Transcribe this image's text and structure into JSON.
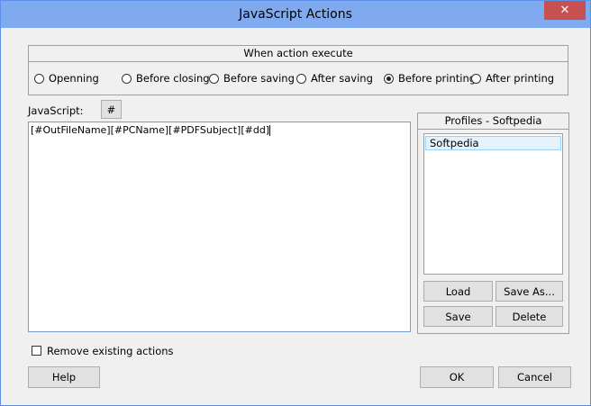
{
  "window": {
    "title": "JavaScript Actions",
    "close_glyph": "✕"
  },
  "action_group": {
    "title": "When action execute",
    "options": [
      {
        "label": "Openning",
        "selected": false
      },
      {
        "label": "Before closing",
        "selected": false
      },
      {
        "label": "Before saving",
        "selected": false
      },
      {
        "label": "After saving",
        "selected": false
      },
      {
        "label": "Before printing",
        "selected": true
      },
      {
        "label": "After printing",
        "selected": false
      }
    ]
  },
  "javascript": {
    "label": "JavaScript:",
    "insert_button": "#",
    "value": "[#OutFileName][#PCName][#PDFSubject][#dd]"
  },
  "profiles": {
    "title": "Profiles - Softpedia",
    "items": [
      {
        "label": "Softpedia",
        "selected": true
      }
    ],
    "load_label": "Load",
    "save_as_label": "Save As...",
    "save_label": "Save",
    "delete_label": "Delete"
  },
  "remove_existing": {
    "label": "Remove existing actions",
    "checked": false
  },
  "footer": {
    "help_label": "Help",
    "ok_label": "OK",
    "cancel_label": "Cancel"
  }
}
